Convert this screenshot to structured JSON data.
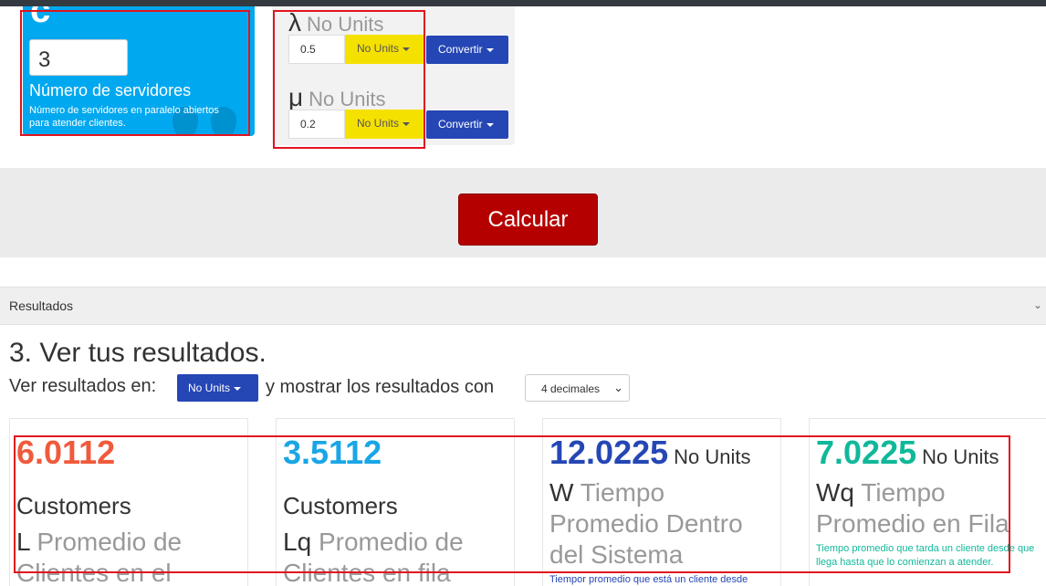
{
  "servers": {
    "letter": "c",
    "value": "3",
    "label": "Número de servidores",
    "description": "Número de servidores en paralelo abiertos para atender clientes."
  },
  "rates": {
    "lambda": {
      "symbol": "λ",
      "units": "No Units",
      "value": "0.5",
      "unit_button": "No Units",
      "convert_button": "Convertir"
    },
    "mu": {
      "symbol": "μ",
      "units": "No Units",
      "value": "0.2",
      "unit_button": "No Units",
      "convert_button": "Convertir"
    }
  },
  "calculate_button": "Calcular",
  "results_section": {
    "header": "Resultados",
    "title": "3. Ver tus resultados.",
    "show_in_label": "Ver resultados en:",
    "units_button": "No Units",
    "mid_text": "y mostrar los resultados con",
    "decimals_select": "4 decimales"
  },
  "cards": [
    {
      "value": "6.0112",
      "value_color": "#f05a3c",
      "units": "",
      "customers": "Customers",
      "symbol": "L",
      "description": "Promedio de Clientes en el",
      "note": ""
    },
    {
      "value": "3.5112",
      "value_color": "#19a6e6",
      "units": "",
      "customers": "Customers",
      "symbol": "Lq",
      "description": "Promedio de Clientes en fila",
      "note": ""
    },
    {
      "value": "12.0225",
      "value_color": "#2546b5",
      "units": "No Units",
      "customers": "",
      "symbol": "W",
      "description": "Tiempo Promedio Dentro del Sistema",
      "note": "Tiempor promedio que está un cliente desde",
      "note_color": "#2546b5"
    },
    {
      "value": "7.0225",
      "value_color": "#10b89a",
      "units": "No Units",
      "customers": "",
      "symbol": "Wq",
      "description": "Tiempo Promedio en Fila",
      "note": "Tiempo promedio que tarda un cliente desde que llega hasta que lo comienzan a atender.",
      "note_color": "#10b89a"
    }
  ]
}
